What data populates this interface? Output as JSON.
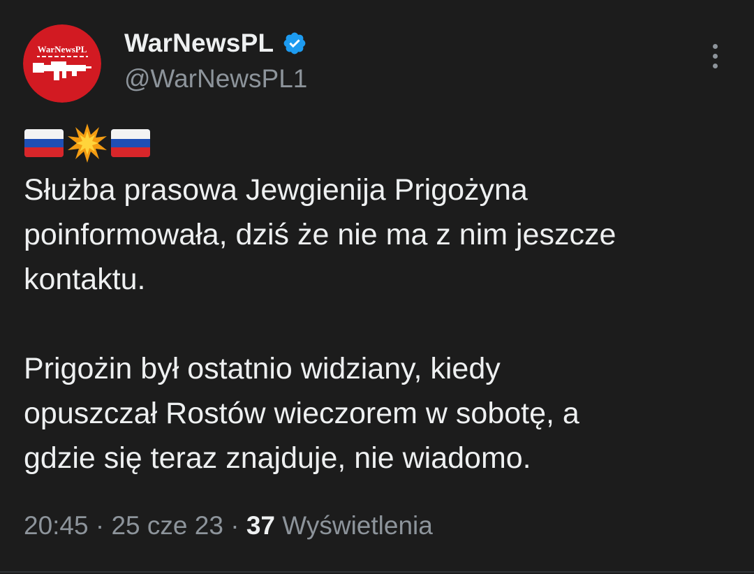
{
  "author": {
    "avatar_text": "WarNewsPL",
    "display_name": "WarNewsPL",
    "handle": "@WarNewsPL1",
    "verified_icon": "verified-badge-icon",
    "avatar_color": "#d21a22"
  },
  "header": {
    "more_icon": "more-vertical-icon"
  },
  "tweet": {
    "emoji": [
      "russia-flag",
      "collision",
      "russia-flag"
    ],
    "paragraph1": [
      "Służba prasowa Jewgienija Prigożyna",
      "poinformowała, dziś że nie ma z nim jeszcze",
      "kontaktu."
    ],
    "paragraph2": [
      "Prigożin był ostatnio widziany, kiedy",
      "opuszczał Rostów wieczorem w sobotę, a",
      "gdzie się teraz znajduje, nie wiadomo."
    ]
  },
  "meta": {
    "time": "20:45",
    "separator": "·",
    "date": "25 cze 23",
    "views_count": "37",
    "views_label": "Wyświetlenia"
  },
  "colors": {
    "background": "#1c1c1c",
    "text": "#eef0f1",
    "muted": "#8d949b",
    "verified": "#1d9bf0"
  }
}
